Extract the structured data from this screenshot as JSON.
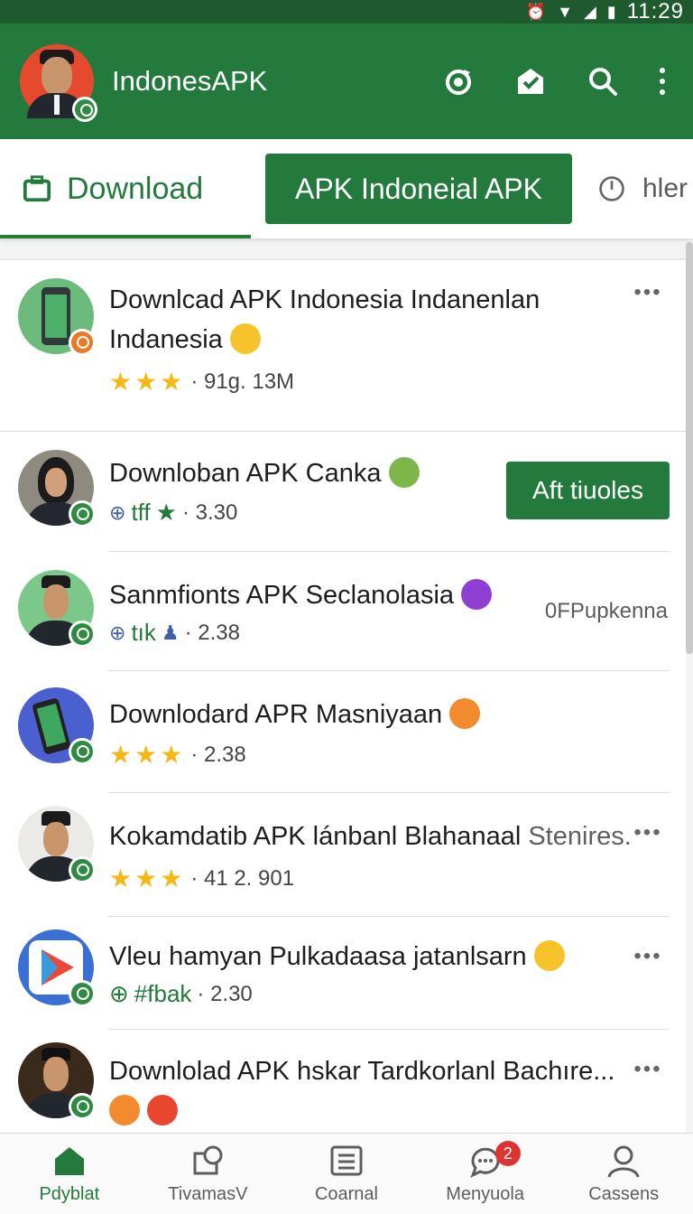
{
  "status_bar": {
    "time": "11:29"
  },
  "app_bar": {
    "title": "IndonesAPK"
  },
  "tabs": {
    "download_label": "Download",
    "apk_label": "APK Indoneial APK",
    "more_label": "hler"
  },
  "list": [
    {
      "title_line1": "Downlcad  APK Indonesia Indanenlan",
      "title_line2": "Indanesia",
      "meta": "· 91g. 13M",
      "rating_stars": 3
    },
    {
      "title_line1": "Downloban APK Canka",
      "tag": "tff",
      "meta": "· 3.30",
      "action_label": "Aft tiuoles"
    },
    {
      "title_line1": "Sanmfionts APK Seclanolasia",
      "tag": "tık",
      "meta": "· 2.38",
      "side_label": "0FPupkenna"
    },
    {
      "title_line1": "Downlodard APR Masniyaan",
      "meta": "· 2.38",
      "rating_stars": 3
    },
    {
      "title_line1": "Kokamdatib APK lánbanl Blahanaal",
      "title_dim": "Stenires.",
      "meta": "· 41 2. 901",
      "rating_stars": 3
    },
    {
      "title_line1": "Vleu hamyan  Pulkadaasa jatanlsarn",
      "tag": "#fbak",
      "meta": "· 2.30"
    },
    {
      "title_line1": "Downlolad APK hskar Tardkorlanl Bachıre..."
    }
  ],
  "bottom_nav": [
    {
      "label": "Pdyblat",
      "active": true
    },
    {
      "label": "TivamasV"
    },
    {
      "label": "Coarnal"
    },
    {
      "label": "Menyuola",
      "badge": "2"
    },
    {
      "label": "Cassens"
    }
  ],
  "colors": {
    "brand": "#247a3d",
    "status": "#1f5a2f",
    "star": "#f5b816"
  }
}
